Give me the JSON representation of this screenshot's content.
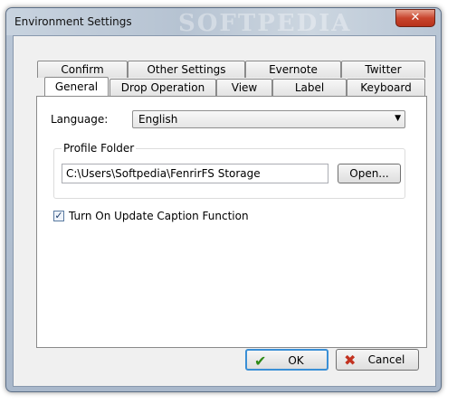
{
  "window": {
    "title": "Environment Settings",
    "watermark": "SOFTPEDIA",
    "close_glyph": "✕"
  },
  "tabs": {
    "row_back": [
      "Confirm",
      "Other Settings",
      "Evernote",
      "Twitter"
    ],
    "row_front": [
      "General",
      "Drop Operation",
      "View",
      "Label",
      "Keyboard"
    ],
    "active": "General"
  },
  "general": {
    "language_label": "Language:",
    "language_value": "English",
    "profile_folder_label": "Profile Folder",
    "profile_folder_value": "C:\\Users\\Softpedia\\FenrirFS Storage",
    "open_button": "Open...",
    "caption_checkbox_label": "Turn On Update Caption Function",
    "caption_checked": true
  },
  "footer": {
    "ok_label": "OK",
    "cancel_label": "Cancel"
  },
  "colors": {
    "accent": "#3a8fd6",
    "ok_icon": "#2f8a17",
    "cancel_icon": "#c23220",
    "close_button": "#c8452d"
  },
  "icons": {
    "ok": "check-icon",
    "cancel": "x-icon",
    "close": "close-icon",
    "dropdown": "chevron-down-icon"
  }
}
